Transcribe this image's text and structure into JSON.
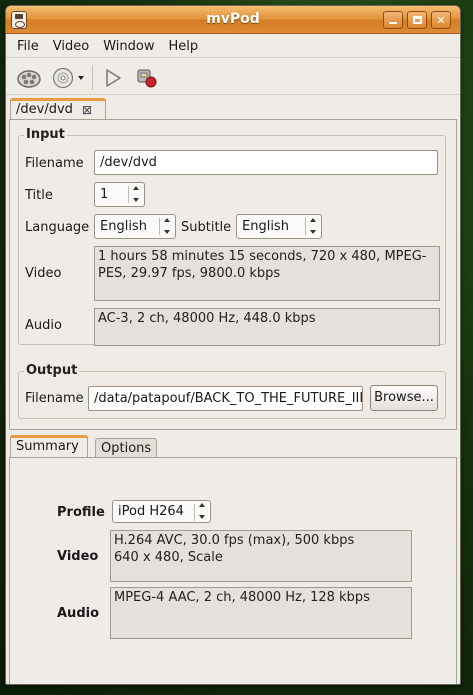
{
  "window": {
    "title": "mvPod"
  },
  "menu": [
    "File",
    "Video",
    "Window",
    "Help"
  ],
  "toolbar": {
    "items": [
      {
        "icon": "film-reel-icon"
      },
      {
        "icon": "dvd-disc-icon",
        "has_dropdown": true
      },
      {
        "icon": "play-icon"
      },
      {
        "icon": "encode-icon"
      }
    ]
  },
  "doc_tab": {
    "label": "/dev/dvd",
    "close": "⊠"
  },
  "input": {
    "label": "Input",
    "filename_label": "Filename",
    "filename_value": "/dev/dvd",
    "title_label": "Title",
    "title_value": "1",
    "language_label": "Language",
    "language_value": "English",
    "subtitle_label": "Subtitle",
    "subtitle_value": "English",
    "video_label": "Video",
    "video_lines": [
      "1 hours 58 minutes 15 seconds, 720 x 480, MPEG-",
      "PES, 29.97 fps, 9800.0 kbps"
    ],
    "audio_label": "Audio",
    "audio_lines": [
      "AC-3, 2 ch, 48000 Hz, 448.0 kbps"
    ]
  },
  "output": {
    "label": "Output",
    "filename_label": "Filename",
    "filename_value": "/data/patapouf/BACK_TO_THE_FUTURE_III.m",
    "browse_label": "Browse..."
  },
  "bottom_tabs": [
    "Summary",
    "Options"
  ],
  "summary": {
    "profile_label": "Profile",
    "profile_value": "iPod H264",
    "video_label": "Video",
    "video_lines": [
      "H.264 AVC, 30.0 fps (max), 500 kbps",
      "640 x 480, Scale"
    ],
    "audio_label": "Audio",
    "audio_lines": [
      "MPEG-4 AAC, 2 ch, 48000 Hz, 128 kbps"
    ]
  }
}
